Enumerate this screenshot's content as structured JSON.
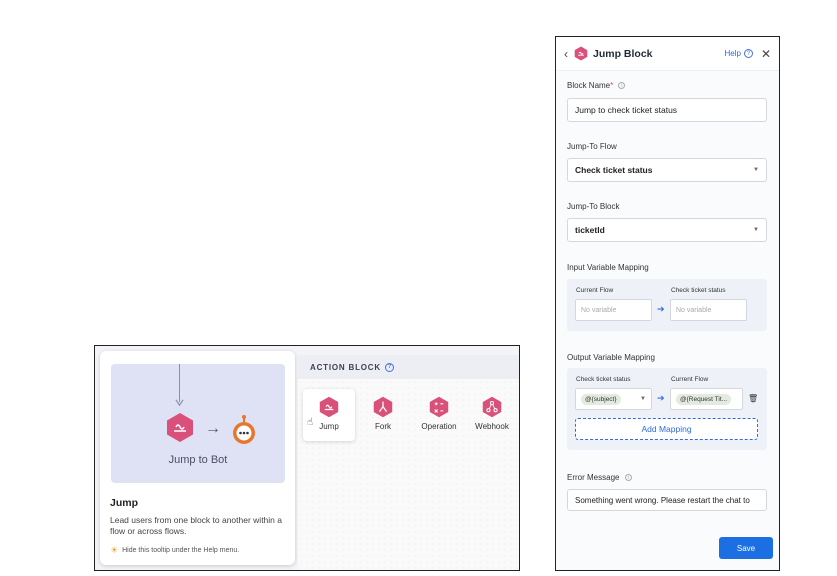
{
  "left_panel": {
    "action_header": "ACTION BLOCK",
    "tooltip": {
      "illustration_caption": "Jump to Bot",
      "title": "Jump",
      "description": "Lead users from one block to another within a flow or across flows.",
      "hint": "Hide this tooltip under the Help menu."
    },
    "actions": [
      {
        "label": "Jump"
      },
      {
        "label": "Fork"
      },
      {
        "label": "Operation"
      },
      {
        "label": "Webhook"
      }
    ]
  },
  "panel": {
    "title": "Jump Block",
    "help_label": "Help",
    "block_name": {
      "label": "Block Name",
      "required": "*",
      "value": "Jump to check ticket status"
    },
    "jump_to_flow": {
      "label": "Jump-To Flow",
      "value": "Check ticket status"
    },
    "jump_to_block": {
      "label": "Jump-To Block",
      "value": "ticketId"
    },
    "input_mapping": {
      "label": "Input Variable Mapping",
      "left_col": "Current Flow",
      "right_col": "Check ticket status",
      "left_placeholder": "No variable",
      "right_placeholder": "No variable"
    },
    "output_mapping": {
      "label": "Output Variable Mapping",
      "left_col": "Check ticket status",
      "right_col": "Current Flow",
      "left_value": "@{subject}",
      "right_value": "@{Request Tit...",
      "add_label": "Add Mapping"
    },
    "error_message": {
      "label": "Error Message",
      "value": "Something went wrong. Please restart the chat to"
    },
    "save_label": "Save"
  },
  "colors": {
    "accent": "#1c6fe3",
    "block_pink": "#d9507a",
    "bot_orange": "#e8772e"
  }
}
